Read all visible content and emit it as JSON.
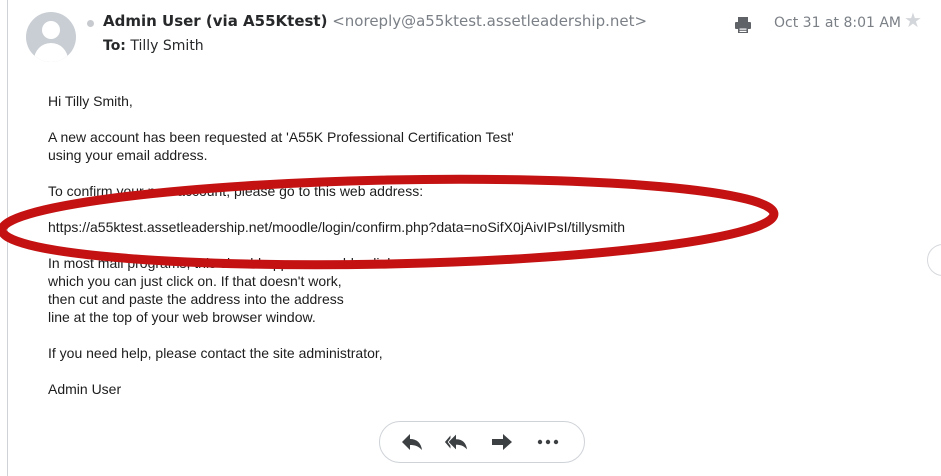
{
  "header": {
    "sender_name": "Admin User (via A55Ktest)",
    "sender_email": "<noreply@a55ktest.assetleadership.net>",
    "to_label": "To:",
    "to_name": "Tilly Smith",
    "date": "Oct 31 at 8:01 AM"
  },
  "message": {
    "greeting": "Hi Tilly Smith,",
    "para1_line1": "A new account has been requested at 'A55K Professional Certification Test'",
    "para1_line2": "using your email address.",
    "para2": "To confirm your new account, please go to this web address:",
    "link": "https://a55ktest.assetleadership.net/moodle/login/confirm.php?data=noSifX0jAivIPsI/tillysmith",
    "para3_line1": "In most mail programs, this should appear as a blue link",
    "para3_line2": "which you can just click on. If that doesn't work,",
    "para3_line3": "then cut and paste the address into the address",
    "para3_line4": "line at the top of your web browser window.",
    "para4": "If you need help, please contact the site administrator,",
    "signature": "Admin User"
  },
  "icons": {
    "printer": "printer-icon",
    "star": "star-icon",
    "reply": "reply-icon",
    "reply_all": "reply-all-icon",
    "forward": "forward-icon",
    "more": "more-icon"
  },
  "colors": {
    "annotation_ellipse": "#c41212",
    "secondary_text": "#7b8087"
  }
}
